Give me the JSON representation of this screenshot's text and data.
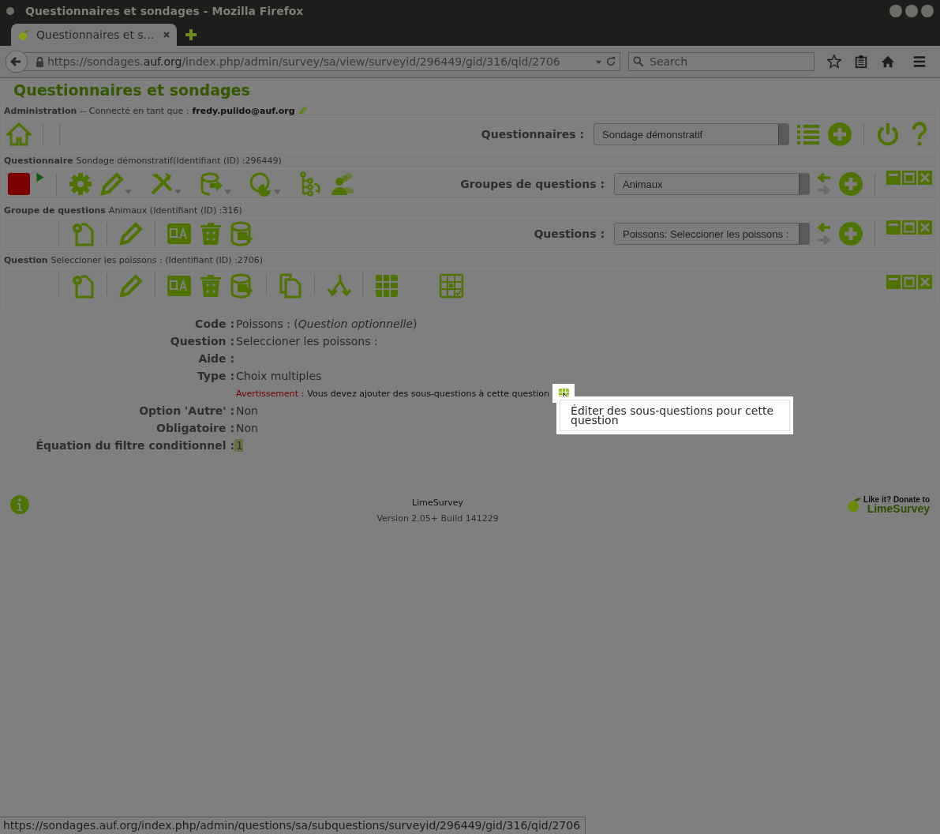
{
  "window": {
    "title": "Questionnaires et sondages - Mozilla Firefox"
  },
  "tabs": [
    {
      "label": "Questionnaires et s…",
      "selected": true
    }
  ],
  "address_bar": {
    "url_prefix": "https://sondages.",
    "url_domain": "auf.org",
    "url_path": "/index.php/admin/survey/sa/view/surveyid/296449/gid/316/qid/2706"
  },
  "search": {
    "placeholder": "Search"
  },
  "page": {
    "title": "Questionnaires et sondages",
    "admin_bar": {
      "label": "Administration",
      "text": "-- Connecté en tant que :",
      "user": "fredy.pulido@auf.org"
    },
    "survey_selector": {
      "label": "Questionnaires :",
      "value": "Sondage démonstratif"
    },
    "survey_bar": {
      "label": "Questionnaire",
      "text": "Sondage démonstratif(Identifiant (ID) :296449)"
    },
    "group_selector": {
      "label": "Groupes de questions :",
      "value": "Animaux"
    },
    "group_bar": {
      "label": "Groupe de questions",
      "text": "Animaux (Identifiant (ID) :316)"
    },
    "question_selector": {
      "label": "Questions :",
      "value": "Poissons: Seleccioner les poissons :"
    },
    "question_bar": {
      "label": "Question",
      "text": "Seleccioner les poissons : (Identifiant (ID) :2706)"
    },
    "details": [
      {
        "label": "Code :",
        "value": "Poissons : (*Question optionnelle*)"
      },
      {
        "label": "Question :",
        "value": "Seleccioner les poissons :"
      },
      {
        "label": "Aide :"
      },
      {
        "label": "Type :",
        "value": "Choix multiples"
      },
      {
        "label": "Option 'Autre' :",
        "value": "Non"
      },
      {
        "label": "Obligatoire :",
        "value": "Non"
      },
      {
        "label": "Équation du filtre conditionnel :",
        "value": "1",
        "highlighted": true
      }
    ],
    "warning": {
      "label": "Avertissement :",
      "text": "Vous devez ajouter des sous-questions à cette question"
    },
    "tooltip": "Éditer des sous-questions pour cette question",
    "footer": {
      "name": "LimeSurvey",
      "version": "Version 2.05+ Build 141229",
      "donate_line1": "Like it? Donate to",
      "donate_line2": "LimeSurvey"
    }
  },
  "status_bar": {
    "url": "https://sondages.auf.org/index.php/admin/questions/sa/subquestions/surveyid/296449/gid/316/qid/2706"
  }
}
